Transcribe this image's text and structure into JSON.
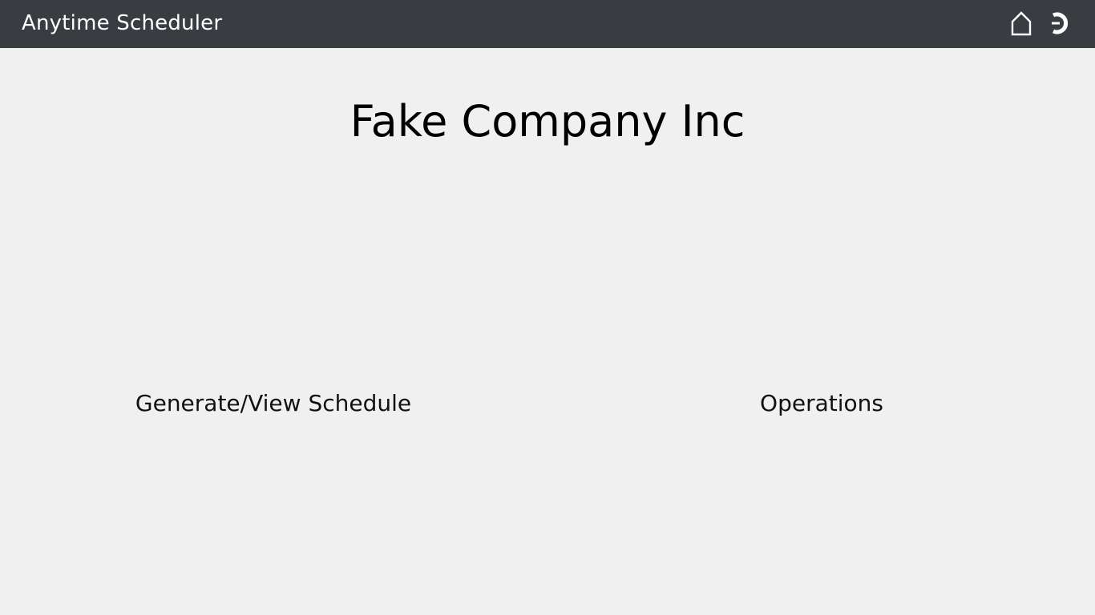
{
  "header": {
    "app_title": "Anytime Scheduler",
    "icons": {
      "home": "home-icon",
      "logout": "logout-icon"
    },
    "background_color": "#393d42"
  },
  "main": {
    "company_name": "Fake Company Inc",
    "links": {
      "generate_view_schedule": "Generate/View Schedule",
      "operations": "Operations"
    },
    "background_color": "#f0f0f0"
  }
}
